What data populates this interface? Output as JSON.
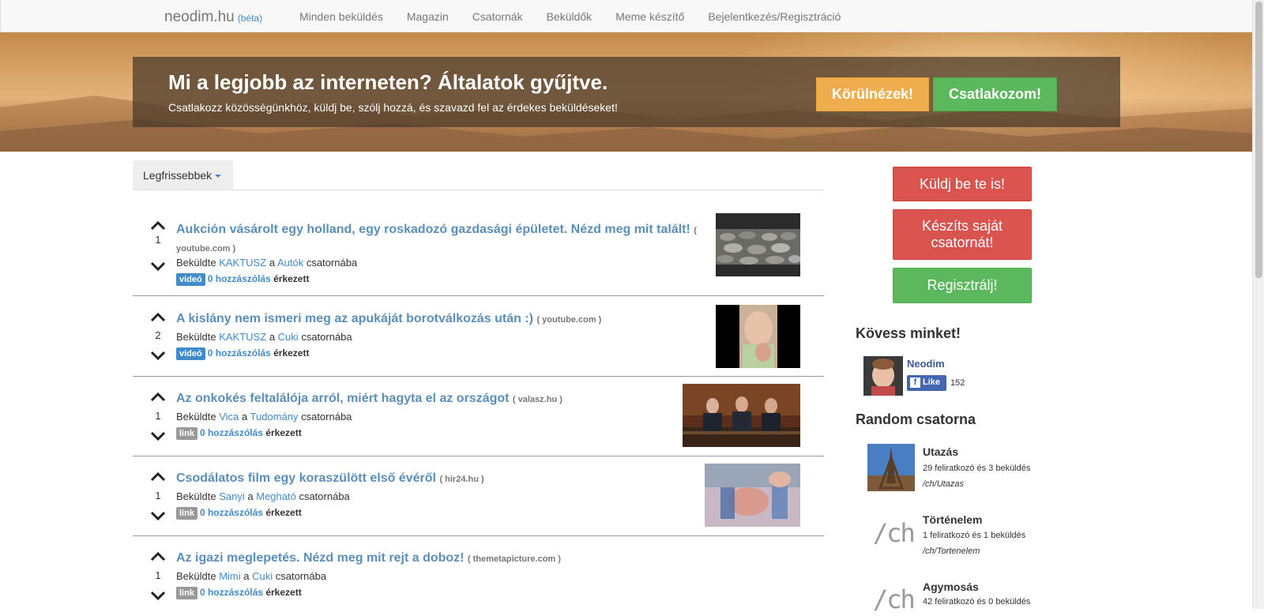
{
  "navbar": {
    "brand": "neodim.hu",
    "beta": "(béta)",
    "links": [
      "Minden beküldés",
      "Magazin",
      "Csatornák",
      "Beküldők",
      "Meme készítő",
      "Bejelentkezés/Regisztráció"
    ]
  },
  "hero": {
    "title": "Mi a legjobb az interneten? Általatok gyűjtve.",
    "subtitle": "Csatlakozz közösségünkhöz, küldj be, szólj hozzá, és szavazd fel az érdekes beküldéseket!",
    "look_button": "Körülnézek!",
    "join_button": "Csatlakozom!"
  },
  "sort": {
    "label": "Legfrissebbek"
  },
  "posts": [
    {
      "title": "Aukción vásárolt egy holland, egy roskadozó gazdasági épületet. Nézd meg mit talált!",
      "domain_open": "(",
      "domain": "youtube.com )",
      "votes": "1",
      "byline_prefix": "Beküldte",
      "user": "KAKTUSZ",
      "a": "a",
      "channel": "Autók",
      "byline_suffix": "csatornába",
      "label": "videó",
      "comments": "0 hozzászólás",
      "arrived": "érkezett"
    },
    {
      "title": "A kislány nem ismeri meg az apukáját borotválkozás után :)",
      "domain": "( youtube.com )",
      "votes": "2",
      "byline_prefix": "Beküldte",
      "user": "KAKTUSZ",
      "a": "a",
      "channel": "Cuki",
      "byline_suffix": "csatornába",
      "label": "videó",
      "comments": "0 hozzászólás",
      "arrived": "érkezett"
    },
    {
      "title": "Az onkokés feltalálója arról, miért hagyta el az országot",
      "domain": "( valasz.hu )",
      "votes": "1",
      "byline_prefix": "Beküldte",
      "user": "Vica",
      "a": "a",
      "channel": "Tudomány",
      "byline_suffix": "csatornába",
      "label": "link",
      "comments": "0 hozzászólás",
      "arrived": "érkezett"
    },
    {
      "title": "Csodálatos film egy koraszülött első évéről",
      "domain": "( hir24.hu )",
      "votes": "1",
      "byline_prefix": "Beküldte",
      "user": "Sanyi",
      "a": "a",
      "channel": "Megható",
      "byline_suffix": "csatornába",
      "label": "link",
      "comments": "0 hozzászólás",
      "arrived": "érkezett"
    },
    {
      "title": "Az igazi meglepetés. Nézd meg mit rejt a doboz!",
      "domain": "( themetapicture.com )",
      "votes": "1",
      "byline_prefix": "Beküldte",
      "user": "Mimi",
      "a": "a",
      "channel": "Cuki",
      "byline_suffix": "csatornába",
      "label": "link",
      "comments": "0 hozzászólás",
      "arrived": "érkezett"
    }
  ],
  "sidebar": {
    "submit_button": "Küldj be te is!",
    "create_channel_button": "Készíts saját csatornát!",
    "register_button": "Regisztrálj!",
    "follow_heading": "Kövess minket!",
    "fb_name": "Neodim",
    "fb_like": "Like",
    "fb_count": "152",
    "random_heading": "Random csatorna",
    "channels": [
      {
        "name": "Utazás",
        "stats": "29 feliratkozó és 3 beküldés",
        "path": "/ch/Utazas"
      },
      {
        "name": "Történelem",
        "stats": "1 feliratkozó és 1 beküldés",
        "path": "/ch/Tortenelem",
        "placeholder": "/ch"
      },
      {
        "name": "Agymosás",
        "stats": "42 feliratkozó és 0 beküldés",
        "placeholder": "/ch"
      }
    ]
  },
  "colors": {
    "link": "#428bca",
    "post_title": "#5b8fb9",
    "orange": "#f0ad4e",
    "green": "#5cb85c",
    "red": "#d9534f"
  }
}
